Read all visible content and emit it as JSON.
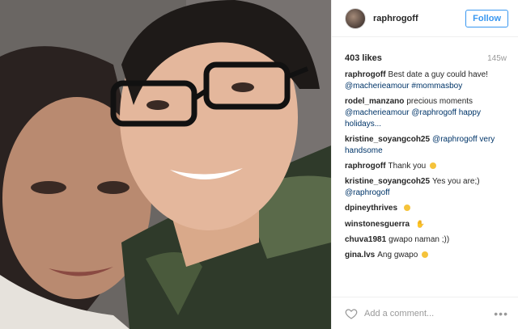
{
  "post": {
    "username": "raphrogoff",
    "follow_label": "Follow",
    "likes": "403 likes",
    "age": "145w",
    "comments": [
      {
        "author": "raphrogoff",
        "text": "Best date a guy could have!",
        "mentions": "@macherieamour #mommasboy",
        "emoji": ""
      },
      {
        "author": "rodel_manzano",
        "text": "precious moments",
        "mentions": "@macherieamour @raphrogoff happy holidays...",
        "emoji": ""
      },
      {
        "author": "kristine_soyangcoh25",
        "text": "",
        "mentions": "@raphrogoff very handsome",
        "emoji": ""
      },
      {
        "author": "raphrogoff",
        "text": "Thank you",
        "mentions": "",
        "emoji": "smiley-face"
      },
      {
        "author": "kristine_soyangcoh25",
        "text": "Yes you are;)",
        "mentions": "@raphrogoff",
        "emoji": ""
      },
      {
        "author": "dpineythrives",
        "text": "",
        "mentions": "",
        "emoji": "smiley-face"
      },
      {
        "author": "winstonesguerra",
        "text": "",
        "mentions": "",
        "emoji": "thumbs-up"
      },
      {
        "author": "chuva1981",
        "text": "gwapo naman ;))",
        "mentions": "",
        "emoji": ""
      },
      {
        "author": "gina.lvs",
        "text": "Ang gwapo",
        "mentions": "",
        "emoji": "heart-eyes-face"
      }
    ],
    "comment_placeholder": "Add a comment...",
    "more_label": "•••"
  },
  "colors": {
    "accent": "#3897f0",
    "mention": "#003569"
  },
  "icons": {
    "like": "heart-icon",
    "more": "more-options-icon"
  }
}
